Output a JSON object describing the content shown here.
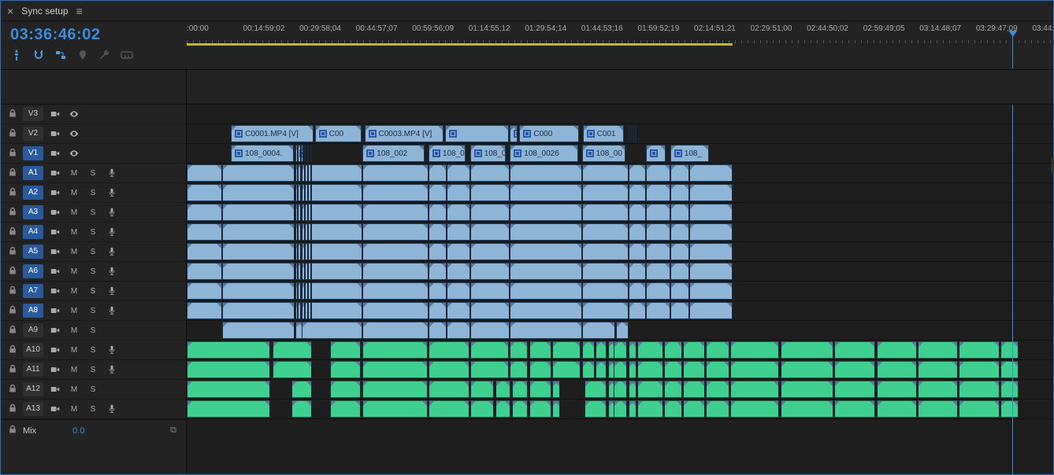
{
  "header": {
    "title": "Sync setup",
    "close": "×",
    "menu": "≡"
  },
  "timecode": "03:36:46:02",
  "tools": [
    "snap",
    "magnet",
    "link",
    "marker",
    "wrench",
    "cc"
  ],
  "ruler": {
    "ticks": [
      ":00:00",
      "00:14:59;02",
      "00:29:58;04",
      "00:44:57;07",
      "00:59:56;09",
      "01:14:55;12",
      "01:29:54;14",
      "01:44:53;16",
      "01:59:52;19",
      "02:14:51;21",
      "02:29:51;00",
      "02:44:50;02",
      "02:59:49;05",
      "03:14:48;07",
      "03:29:47;09",
      "03:44:4"
    ],
    "work_area_end_pct": 63,
    "playhead_pct": 95.3
  },
  "video_tracks": [
    {
      "id": "V3",
      "selected": false
    },
    {
      "id": "V2",
      "selected": false
    },
    {
      "id": "V1",
      "selected": true
    }
  ],
  "audio_tracks": [
    {
      "id": "A1",
      "selected": true,
      "rec": true
    },
    {
      "id": "A2",
      "selected": true,
      "rec": true
    },
    {
      "id": "A3",
      "selected": true,
      "rec": true
    },
    {
      "id": "A4",
      "selected": true,
      "rec": true
    },
    {
      "id": "A5",
      "selected": true,
      "rec": true
    },
    {
      "id": "A6",
      "selected": true,
      "rec": true
    },
    {
      "id": "A7",
      "selected": true,
      "rec": true
    },
    {
      "id": "A8",
      "selected": true,
      "rec": true
    },
    {
      "id": "A9",
      "selected": false,
      "rec": false
    },
    {
      "id": "A10",
      "selected": false,
      "rec": true
    },
    {
      "id": "A11",
      "selected": false,
      "rec": true
    },
    {
      "id": "A12",
      "selected": false,
      "rec": false
    },
    {
      "id": "A13",
      "selected": false,
      "rec": true
    }
  ],
  "track_btns": {
    "mute": "M",
    "solo": "S"
  },
  "mix": {
    "label": "Mix",
    "value": "0.0"
  },
  "v2_clips": [
    {
      "label": "C0001.MP4 [V]",
      "start": 5.1,
      "end": 14.6
    },
    {
      "label": "C00",
      "start": 14.8,
      "end": 20.2
    },
    {
      "label": "C0003.MP4 [V]",
      "start": 20.5,
      "end": 29.6
    },
    {
      "label": "",
      "start": 29.8,
      "end": 37.2
    },
    {
      "label": "",
      "start": 37.3,
      "end": 38.2
    },
    {
      "label": "C000",
      "start": 38.4,
      "end": 45.3
    },
    {
      "label": "C001",
      "start": 45.7,
      "end": 50.5
    }
  ],
  "v1_clips": [
    {
      "label": "108_0004.",
      "start": 5.1,
      "end": 12.4
    },
    {
      "label": "",
      "start": 12.5,
      "end": 13.0
    },
    {
      "label": "108_002",
      "start": 20.3,
      "end": 27.5
    },
    {
      "label": "108_0",
      "start": 27.9,
      "end": 32.2
    },
    {
      "label": "108_0",
      "start": 32.7,
      "end": 36.8
    },
    {
      "label": "108_0026",
      "start": 37.3,
      "end": 45.2
    },
    {
      "label": "108_00",
      "start": 45.6,
      "end": 50.6
    },
    {
      "label": "",
      "start": 53.0,
      "end": 55.3
    },
    {
      "label": "108_",
      "start": 55.8,
      "end": 60.3
    }
  ],
  "audio_blue_segments": [
    0,
    4.1,
    12.5,
    13.3,
    20.3,
    27.9,
    30.0,
    32.7,
    37.3,
    45.6,
    51.0,
    53.0,
    55.8,
    58.0,
    63.0
  ],
  "audio_a9_segments": [
    4.1,
    12.5,
    13.3,
    20.3,
    27.9,
    30.0,
    32.7,
    37.3,
    45.6,
    49.5,
    51.0
  ],
  "green_a10_a11": [
    [
      0,
      9.6
    ],
    [
      9.9,
      14.5
    ],
    [
      16.5,
      20.1
    ],
    [
      20.3,
      27.8
    ],
    [
      27.9,
      32.6
    ],
    [
      32.7,
      37.2
    ],
    [
      37.3,
      39.4
    ],
    [
      39.5,
      42.1
    ],
    [
      42.2,
      45.5
    ],
    [
      45.6,
      47.1
    ],
    [
      47.2,
      48.5
    ],
    [
      48.6,
      49.2
    ],
    [
      49.3,
      50.8
    ],
    [
      51.0,
      51.8
    ],
    [
      52.0,
      55.0
    ],
    [
      55.1,
      57.2
    ],
    [
      57.3,
      59.8
    ],
    [
      59.9,
      62.6
    ],
    [
      62.7,
      68.4
    ],
    [
      68.5,
      74.6
    ],
    [
      74.7,
      79.5
    ],
    [
      79.6,
      84.3
    ],
    [
      84.4,
      89.0
    ],
    [
      89.1,
      93.8
    ],
    [
      93.9,
      96.0
    ]
  ],
  "green_a12_a13": [
    [
      0,
      9.6
    ],
    [
      12.1,
      14.5
    ],
    [
      16.5,
      20.1
    ],
    [
      20.3,
      27.8
    ],
    [
      27.9,
      32.6
    ],
    [
      32.7,
      35.5
    ],
    [
      35.6,
      37.4
    ],
    [
      37.5,
      39.4
    ],
    [
      39.5,
      42.1
    ],
    [
      42.2,
      43.1
    ],
    [
      45.9,
      48.5
    ],
    [
      48.6,
      49.2
    ],
    [
      49.3,
      50.8
    ],
    [
      51.0,
      51.8
    ],
    [
      52.0,
      55.0
    ],
    [
      55.1,
      57.2
    ],
    [
      57.3,
      59.8
    ],
    [
      59.9,
      62.6
    ],
    [
      62.7,
      68.4
    ],
    [
      68.5,
      74.6
    ],
    [
      74.7,
      79.5
    ],
    [
      79.6,
      84.3
    ],
    [
      84.4,
      89.0
    ],
    [
      89.1,
      93.8
    ],
    [
      93.9,
      96.0
    ]
  ],
  "sliver_pcts": [
    12.9,
    13.3,
    13.7,
    14.1,
    50.9
  ]
}
